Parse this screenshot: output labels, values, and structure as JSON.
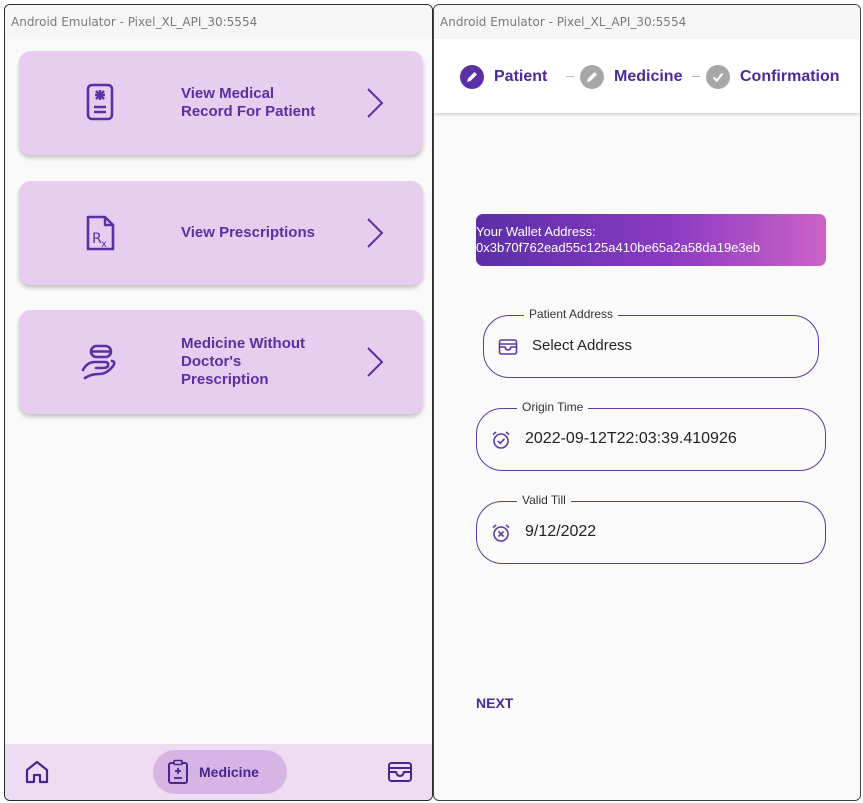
{
  "left_window": {
    "title": "Android Emulator - Pixel_XL_API_30:5554",
    "cards": [
      {
        "label": "View Medical\nRecord For Patient",
        "icon": "medical-record-icon"
      },
      {
        "label": "View Prescriptions",
        "icon": "prescription-icon"
      },
      {
        "label": "Medicine Without\nDoctor's\nPrescription",
        "icon": "hand-pill-icon"
      }
    ],
    "bottom_nav": {
      "home_icon": "home-icon",
      "active_label": "Medicine",
      "active_icon": "clipboard-icon",
      "wallet_icon": "wallet-icon"
    }
  },
  "right_window": {
    "title": "Android Emulator - Pixel_XL_API_30:5554",
    "stepper": [
      {
        "label": "Patient",
        "state": "active"
      },
      {
        "label": "Medicine",
        "state": "pending"
      },
      {
        "label": "Confirmation",
        "state": "pending"
      }
    ],
    "wallet": {
      "label": "Your Wallet Address:",
      "address": "0x3b70f762ead55c125a410be65a2a58da19e3eb"
    },
    "fields": {
      "patient_address": {
        "legend": "Patient Address",
        "value": "Select Address",
        "icon": "wallet-icon"
      },
      "origin_time": {
        "legend": "Origin Time",
        "value": "2022-09-12T22:03:39.410926",
        "icon": "alarm-check-icon"
      },
      "valid_till": {
        "legend": "Valid Till",
        "value": "9/12/2022",
        "icon": "alarm-cancel-icon"
      }
    },
    "next_label": "NEXT"
  },
  "colors": {
    "card_bg": "#e7cdee",
    "primary": "#5c2fa3",
    "step_active": "#5b2fa8",
    "step_pending": "#a7a7a7",
    "gradient_start": "#5a2fa8",
    "gradient_end": "#cc62c6"
  }
}
